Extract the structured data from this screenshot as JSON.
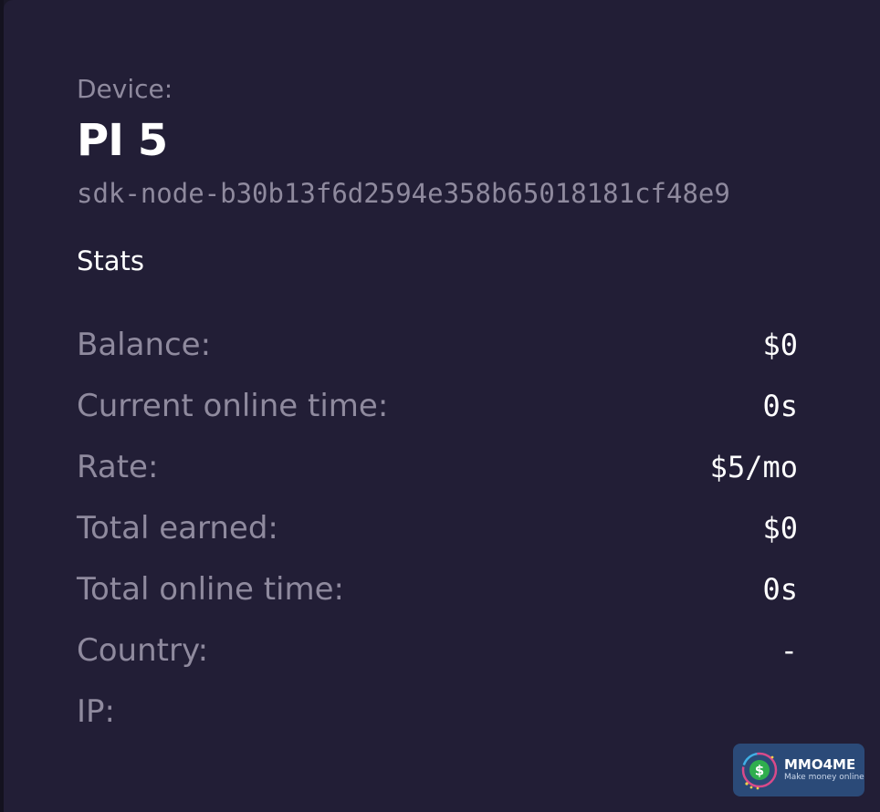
{
  "device": {
    "label": "Device:",
    "name": "PI 5",
    "id": "sdk-node-b30b13f6d2594e358b65018181cf48e9"
  },
  "stats": {
    "heading": "Stats",
    "rows": [
      {
        "label": "Balance:",
        "value": "$0"
      },
      {
        "label": "Current online time:",
        "value": "0s"
      },
      {
        "label": "Rate:",
        "value": "$5/mo"
      },
      {
        "label": "Total earned:",
        "value": "$0"
      },
      {
        "label": "Total online time:",
        "value": "0s"
      },
      {
        "label": "Country:",
        "value": "-"
      },
      {
        "label": "IP:",
        "value": ""
      }
    ]
  },
  "watermark": {
    "title": "MMO4ME",
    "subtitle": "Make money online",
    "icon": "dollar-coin-logo"
  },
  "colors": {
    "background": "#221e36",
    "muted_text": "#8f8a9e",
    "primary_text": "#ffffff",
    "watermark_bg": "#2b4a78"
  }
}
